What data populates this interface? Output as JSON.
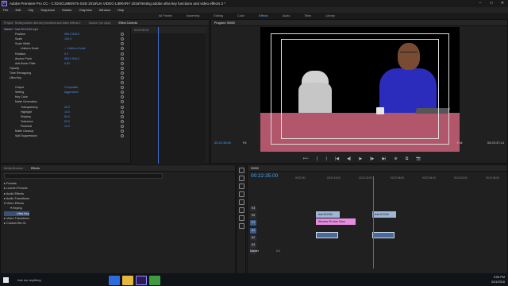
{
  "app": {
    "title": "Adobe Premiere Pro CC - C:\\DOCUMENTS-SSD 2016\\UA VIDEO LIBRARY 2016\\Testing adobe ultra key functions and video effects 2 *",
    "icon": "Pr"
  },
  "menu": [
    "File",
    "Edit",
    "Clip",
    "Sequence",
    "Marker",
    "Graphics",
    "Window",
    "Help"
  ],
  "workspaces": [
    {
      "label": "All Panels",
      "active": false
    },
    {
      "label": "Assembly",
      "active": false
    },
    {
      "label": "Editing",
      "active": false
    },
    {
      "label": "Color",
      "active": false
    },
    {
      "label": "Effects",
      "active": true
    },
    {
      "label": "Audio",
      "active": false
    },
    {
      "label": "Titles",
      "active": false
    },
    {
      "label": "Library",
      "active": false
    }
  ],
  "effect_controls": {
    "tabs": [
      "Project: Testing adobe ultra key functions and video effects 2",
      "Source: (no clips)",
      "Effect Controls"
    ],
    "header": "Master * test 0011234.mp4",
    "tl_timecode": "00:23:00:00",
    "rows": [
      {
        "label": "Position",
        "indent": 2,
        "value": "960.0   540.0"
      },
      {
        "label": "Scale",
        "indent": 2,
        "value": "100.0"
      },
      {
        "label": "Scale Width",
        "indent": 2,
        "value": ""
      },
      {
        "label": "Uniform Scale",
        "indent": 3,
        "value": "✓ Uniform Scale"
      },
      {
        "label": "Rotation",
        "indent": 2,
        "value": "0.0"
      },
      {
        "label": "Anchor Point",
        "indent": 2,
        "value": "960.0   540.0"
      },
      {
        "label": "Anti-flicker Filter",
        "indent": 2,
        "value": "0.00"
      },
      {
        "label": "Opacity",
        "indent": 1,
        "value": ""
      },
      {
        "label": "Time Remapping",
        "indent": 1,
        "value": ""
      },
      {
        "label": "Ultra Key",
        "indent": 1,
        "value": ""
      },
      {
        "label": "",
        "indent": 2,
        "value": ""
      },
      {
        "label": "Output",
        "indent": 2,
        "value": "Composite"
      },
      {
        "label": "Setting",
        "indent": 2,
        "value": "Aggressive"
      },
      {
        "label": "Key Color",
        "indent": 2,
        "value": ""
      },
      {
        "label": "Matte Generation",
        "indent": 2,
        "value": ""
      },
      {
        "label": "Transparency",
        "indent": 3,
        "value": "45.0"
      },
      {
        "label": "Highlight",
        "indent": 3,
        "value": "10.0"
      },
      {
        "label": "Shadow",
        "indent": 3,
        "value": "50.0"
      },
      {
        "label": "Tolerance",
        "indent": 3,
        "value": "50.0"
      },
      {
        "label": "Pedestal",
        "indent": 3,
        "value": "10.0"
      },
      {
        "label": "Matte Cleanup",
        "indent": 2,
        "value": ""
      },
      {
        "label": "Spill Suppression",
        "indent": 2,
        "value": ""
      }
    ]
  },
  "program": {
    "title": "Program: 00000",
    "timecode": "00:22:38:00",
    "fit": "Fit",
    "resolution": "Full",
    "duration": "00:23:37:14",
    "controls": [
      "⟸",
      "{",
      "}",
      "|◀",
      "◀|",
      "▶",
      "|▶",
      "▶|",
      "⊕",
      "⧉",
      "📷"
    ]
  },
  "effects_browser": {
    "tabs": [
      {
        "label": "Media Browser",
        "active": false
      },
      {
        "label": "Effects",
        "active": true
      }
    ],
    "search_placeholder": "",
    "tree": [
      {
        "label": "▸ Presets",
        "indent": 0,
        "selected": false
      },
      {
        "label": "▸ Lumetri Presets",
        "indent": 0,
        "selected": false
      },
      {
        "label": "▸ Audio Effects",
        "indent": 0,
        "selected": false
      },
      {
        "label": "▸ Audio Transitions",
        "indent": 0,
        "selected": false
      },
      {
        "label": "▾ Video Effects",
        "indent": 0,
        "selected": false
      },
      {
        "label": "▾ Keying",
        "indent": 1,
        "selected": false
      },
      {
        "label": "Ultra Key",
        "indent": 2,
        "selected": true
      },
      {
        "label": "▸ Video Transitions",
        "indent": 0,
        "selected": false
      },
      {
        "label": "▸ Custom Bin 01",
        "indent": 0,
        "selected": false
      }
    ]
  },
  "timeline": {
    "sequence": "00000",
    "timecode": "00:22:35:00",
    "ruler": [
      "00:22:00",
      "00:22:16:00",
      "00:22:32:00",
      "00:22:48:00",
      "00:23:04:00",
      "00:23:20:00",
      "00:23:36:00"
    ],
    "tracks": [
      {
        "name": "V3",
        "target": false
      },
      {
        "name": "V2",
        "target": false
      },
      {
        "name": "V1",
        "target": true
      },
      {
        "name": "A1",
        "target": true
      },
      {
        "name": "A2",
        "target": false
      },
      {
        "name": "A3",
        "target": false
      },
      {
        "name": "Master",
        "target": false
      }
    ],
    "master_value": "0.0",
    "clips": [
      {
        "label": "test 001234",
        "color": "#9db6d6"
      },
      {
        "label": "test 001234",
        "color": "#9db6d6"
      },
      {
        "label": "Window 09 Lime Glow",
        "color": "#e58ee0"
      },
      {
        "label": "",
        "color": "#4a6a9a"
      },
      {
        "label": "",
        "color": "#4a6a9a"
      }
    ]
  },
  "taskbar": {
    "search_placeholder": "Ask me anything",
    "time": "9:06 PM",
    "date": "6/11/2016"
  }
}
